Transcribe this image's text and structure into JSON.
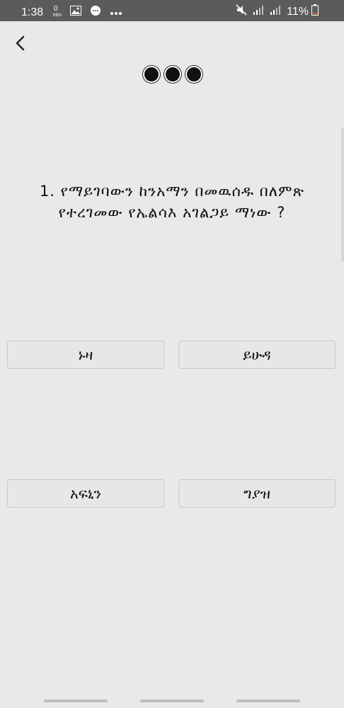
{
  "status_bar": {
    "time": "1:38",
    "net_speed": "0 KB/s",
    "battery_percent": "11%",
    "icons": [
      "data-speed-icon",
      "image-icon",
      "chat-icon",
      "more-icon",
      "mute-icon",
      "signal-icon",
      "signal-icon",
      "battery-icon"
    ]
  },
  "header": {
    "back_icon": "chevron-left-icon",
    "progress_dots": 3
  },
  "quiz": {
    "question": "1. የማይገባውን ከንአማን በመዉሰዱ በለምጽ የተረገመው የኤልሳእ አገልጋይ ማነው ?",
    "answers": [
      "ኑዛ",
      "ይሁዳ",
      "አፍኒን",
      "ግያዝ"
    ]
  }
}
